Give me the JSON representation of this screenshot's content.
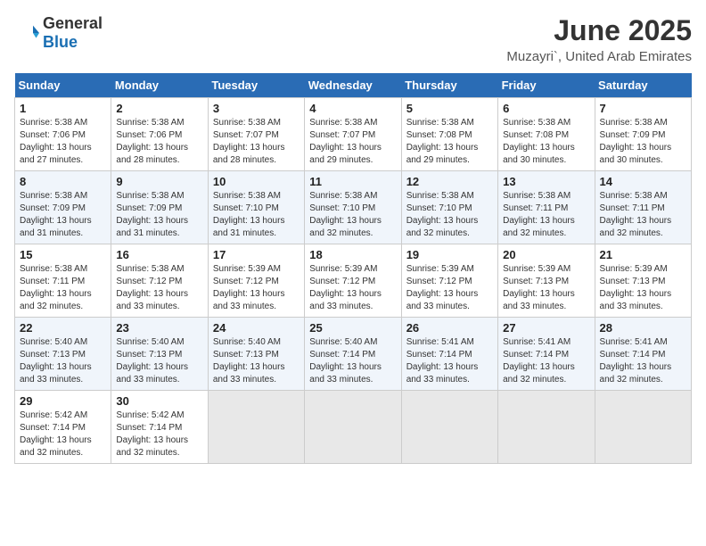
{
  "logo": {
    "text_general": "General",
    "text_blue": "Blue"
  },
  "header": {
    "month_year": "June 2025",
    "location": "Muzayri`, United Arab Emirates"
  },
  "weekdays": [
    "Sunday",
    "Monday",
    "Tuesday",
    "Wednesday",
    "Thursday",
    "Friday",
    "Saturday"
  ],
  "weeks": [
    [
      {
        "day": "1",
        "info": "Sunrise: 5:38 AM\nSunset: 7:06 PM\nDaylight: 13 hours and 27 minutes."
      },
      {
        "day": "2",
        "info": "Sunrise: 5:38 AM\nSunset: 7:06 PM\nDaylight: 13 hours and 28 minutes."
      },
      {
        "day": "3",
        "info": "Sunrise: 5:38 AM\nSunset: 7:07 PM\nDaylight: 13 hours and 28 minutes."
      },
      {
        "day": "4",
        "info": "Sunrise: 5:38 AM\nSunset: 7:07 PM\nDaylight: 13 hours and 29 minutes."
      },
      {
        "day": "5",
        "info": "Sunrise: 5:38 AM\nSunset: 7:08 PM\nDaylight: 13 hours and 29 minutes."
      },
      {
        "day": "6",
        "info": "Sunrise: 5:38 AM\nSunset: 7:08 PM\nDaylight: 13 hours and 30 minutes."
      },
      {
        "day": "7",
        "info": "Sunrise: 5:38 AM\nSunset: 7:09 PM\nDaylight: 13 hours and 30 minutes."
      }
    ],
    [
      {
        "day": "8",
        "info": "Sunrise: 5:38 AM\nSunset: 7:09 PM\nDaylight: 13 hours and 31 minutes."
      },
      {
        "day": "9",
        "info": "Sunrise: 5:38 AM\nSunset: 7:09 PM\nDaylight: 13 hours and 31 minutes."
      },
      {
        "day": "10",
        "info": "Sunrise: 5:38 AM\nSunset: 7:10 PM\nDaylight: 13 hours and 31 minutes."
      },
      {
        "day": "11",
        "info": "Sunrise: 5:38 AM\nSunset: 7:10 PM\nDaylight: 13 hours and 32 minutes."
      },
      {
        "day": "12",
        "info": "Sunrise: 5:38 AM\nSunset: 7:10 PM\nDaylight: 13 hours and 32 minutes."
      },
      {
        "day": "13",
        "info": "Sunrise: 5:38 AM\nSunset: 7:11 PM\nDaylight: 13 hours and 32 minutes."
      },
      {
        "day": "14",
        "info": "Sunrise: 5:38 AM\nSunset: 7:11 PM\nDaylight: 13 hours and 32 minutes."
      }
    ],
    [
      {
        "day": "15",
        "info": "Sunrise: 5:38 AM\nSunset: 7:11 PM\nDaylight: 13 hours and 32 minutes."
      },
      {
        "day": "16",
        "info": "Sunrise: 5:38 AM\nSunset: 7:12 PM\nDaylight: 13 hours and 33 minutes."
      },
      {
        "day": "17",
        "info": "Sunrise: 5:39 AM\nSunset: 7:12 PM\nDaylight: 13 hours and 33 minutes."
      },
      {
        "day": "18",
        "info": "Sunrise: 5:39 AM\nSunset: 7:12 PM\nDaylight: 13 hours and 33 minutes."
      },
      {
        "day": "19",
        "info": "Sunrise: 5:39 AM\nSunset: 7:12 PM\nDaylight: 13 hours and 33 minutes."
      },
      {
        "day": "20",
        "info": "Sunrise: 5:39 AM\nSunset: 7:13 PM\nDaylight: 13 hours and 33 minutes."
      },
      {
        "day": "21",
        "info": "Sunrise: 5:39 AM\nSunset: 7:13 PM\nDaylight: 13 hours and 33 minutes."
      }
    ],
    [
      {
        "day": "22",
        "info": "Sunrise: 5:40 AM\nSunset: 7:13 PM\nDaylight: 13 hours and 33 minutes."
      },
      {
        "day": "23",
        "info": "Sunrise: 5:40 AM\nSunset: 7:13 PM\nDaylight: 13 hours and 33 minutes."
      },
      {
        "day": "24",
        "info": "Sunrise: 5:40 AM\nSunset: 7:13 PM\nDaylight: 13 hours and 33 minutes."
      },
      {
        "day": "25",
        "info": "Sunrise: 5:40 AM\nSunset: 7:14 PM\nDaylight: 13 hours and 33 minutes."
      },
      {
        "day": "26",
        "info": "Sunrise: 5:41 AM\nSunset: 7:14 PM\nDaylight: 13 hours and 33 minutes."
      },
      {
        "day": "27",
        "info": "Sunrise: 5:41 AM\nSunset: 7:14 PM\nDaylight: 13 hours and 32 minutes."
      },
      {
        "day": "28",
        "info": "Sunrise: 5:41 AM\nSunset: 7:14 PM\nDaylight: 13 hours and 32 minutes."
      }
    ],
    [
      {
        "day": "29",
        "info": "Sunrise: 5:42 AM\nSunset: 7:14 PM\nDaylight: 13 hours and 32 minutes."
      },
      {
        "day": "30",
        "info": "Sunrise: 5:42 AM\nSunset: 7:14 PM\nDaylight: 13 hours and 32 minutes."
      },
      {
        "day": "",
        "info": ""
      },
      {
        "day": "",
        "info": ""
      },
      {
        "day": "",
        "info": ""
      },
      {
        "day": "",
        "info": ""
      },
      {
        "day": "",
        "info": ""
      }
    ]
  ]
}
